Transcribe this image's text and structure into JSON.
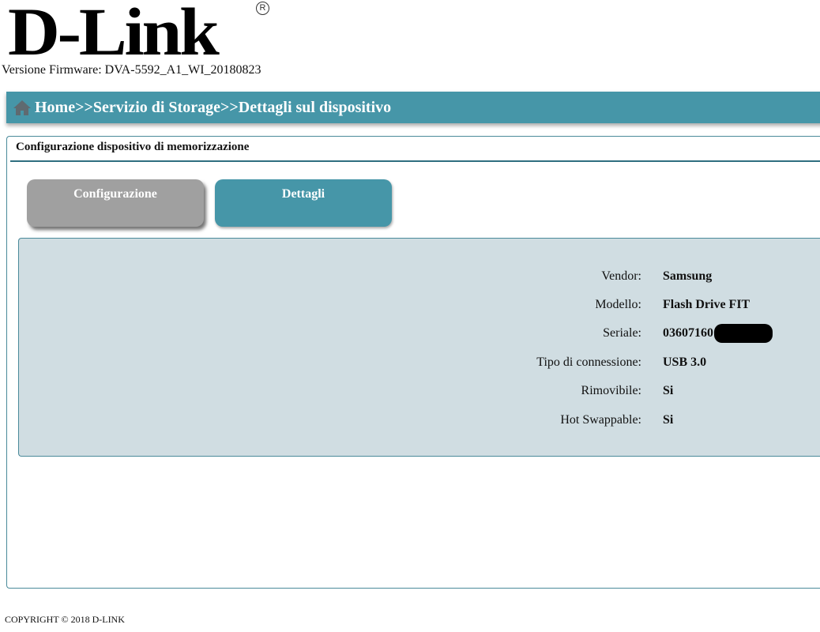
{
  "brand": {
    "logo_text": "D-Link",
    "registered_mark": "R",
    "firmware_label": "Versione Firmware: DVA-5592_A1_WI_20180823"
  },
  "breadcrumb": {
    "path": "Home>>Servizio di Storage>>Dettagli sul dispositivo"
  },
  "section": {
    "title": "Configurazione dispositivo di memorizzazione"
  },
  "tabs": [
    {
      "label": "Configurazione",
      "active": false
    },
    {
      "label": "Dettagli",
      "active": true
    }
  ],
  "details": [
    {
      "label": "Vendor:",
      "value": "Samsung"
    },
    {
      "label": "Modello:",
      "value": "Flash Drive FIT"
    },
    {
      "label": "Seriale:",
      "value": "03607160"
    },
    {
      "label": "Tipo di connessione:",
      "value": "USB 3.0"
    },
    {
      "label": "Rimovibile:",
      "value": "Si"
    },
    {
      "label": "Hot Swappable:",
      "value": "Si"
    }
  ],
  "footer": {
    "copyright": "COPYRIGHT © 2018 D-LINK"
  },
  "colors": {
    "accent": "#4696a8",
    "panel_bg": "#d0dde2",
    "inactive_tab": "#a0a0a0"
  },
  "icons": {
    "home": "home-icon"
  }
}
